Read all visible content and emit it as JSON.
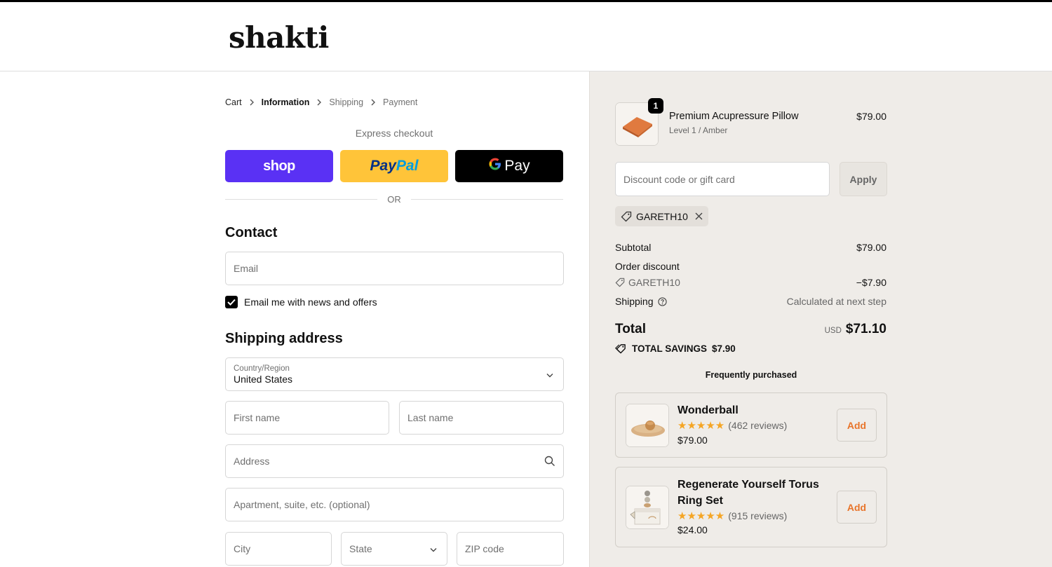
{
  "brand": {
    "logo_text": "shakti"
  },
  "breadcrumb": [
    "Cart",
    "Information",
    "Shipping",
    "Payment"
  ],
  "express": {
    "label": "Express checkout",
    "shop_label": "shop",
    "paypal_part1": "Pay",
    "paypal_part2": "Pal",
    "gpay_g": "G",
    "gpay_label": "Pay",
    "or_label": "OR"
  },
  "contact": {
    "heading": "Contact",
    "email_placeholder": "Email",
    "newsletter_label": "Email me with news and offers",
    "newsletter_checked": true
  },
  "shipping": {
    "heading": "Shipping address",
    "country_label": "Country/Region",
    "country_value": "United States",
    "first_name_placeholder": "First name",
    "last_name_placeholder": "Last name",
    "address_placeholder": "Address",
    "apartment_placeholder": "Apartment, suite, etc. (optional)",
    "city_placeholder": "City",
    "state_placeholder": "State",
    "zip_placeholder": "ZIP code"
  },
  "order": {
    "item": {
      "name": "Premium Acupressure Pillow",
      "variant": "Level 1 / Amber",
      "price": "$79.00",
      "quantity": "1"
    },
    "discount_placeholder": "Discount code or gift card",
    "apply_label": "Apply",
    "applied_code": "GARETH10",
    "subtotal_label": "Subtotal",
    "subtotal_value": "$79.00",
    "order_discount_label": "Order discount",
    "discount_code": "GARETH10",
    "discount_value": "−$7.90",
    "shipping_label": "Shipping",
    "shipping_value": "Calculated at next step",
    "total_label": "Total",
    "currency": "USD",
    "total_value": "$71.10",
    "savings_label": "TOTAL SAVINGS",
    "savings_value": "$7.90"
  },
  "upsell": {
    "title": "Frequently purchased",
    "items": [
      {
        "name": "Wonderball",
        "rating": 5,
        "reviews": "(462 reviews)",
        "price": "$79.00",
        "add_label": "Add"
      },
      {
        "name": "Regenerate Yourself Torus Ring Set",
        "rating": 5,
        "reviews": "(915 reviews)",
        "price": "$24.00",
        "add_label": "Add"
      }
    ]
  },
  "colors": {
    "shop_pay": "#5a31f4",
    "paypal": "#ffc439",
    "gpay": "#000000",
    "summary_bg": "#efece8",
    "star": "#f5a524",
    "add_accent": "#e8742a"
  }
}
